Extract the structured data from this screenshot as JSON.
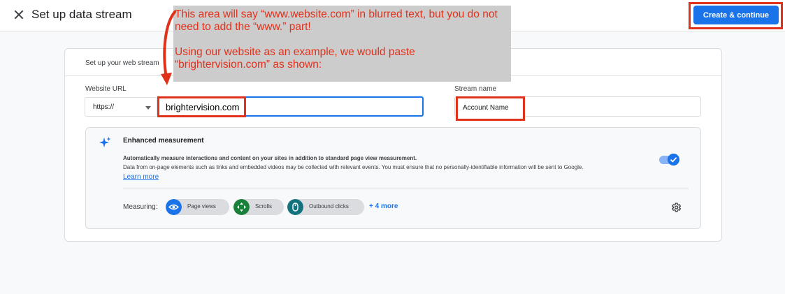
{
  "header": {
    "title": "Set up data stream",
    "cta_label": "Create & continue"
  },
  "card": {
    "heading": "Set up your web stream",
    "website_url_label": "Website URL",
    "protocol_value": "https://",
    "url_value": "brightervision.com",
    "stream_name_label": "Stream name",
    "stream_name_value": "Account Name"
  },
  "enhanced": {
    "title": "Enhanced measurement",
    "desc1": "Automatically measure interactions and content on your sites in addition to standard page view measurement.",
    "desc2": "Data from on-page elements such as links and embedded videos may be collected with relevant events. You must ensure that no personally-identifiable information will be sent to Google.",
    "learn_more": "Learn more",
    "toggle_on": true,
    "measuring_label": "Measuring:",
    "chips": [
      {
        "label": "Page views",
        "icon": "eye-icon",
        "color": "#1a73e8"
      },
      {
        "label": "Scrolls",
        "icon": "crosshair-icon",
        "color": "#188038"
      },
      {
        "label": "Outbound clicks",
        "icon": "mouse-icon",
        "color": "#12727e"
      }
    ],
    "more_label": "+ 4 more"
  },
  "annotation": {
    "text": "This area will say “www.website.com” in blurred text, but you do not need to add the “www.” part!\n\nUsing our website as an example, we would paste “brightervision.com” as shown:",
    "color": "#e0311b"
  },
  "colors": {
    "accent": "#1a73e8",
    "annotation_red": "#e0311b"
  }
}
